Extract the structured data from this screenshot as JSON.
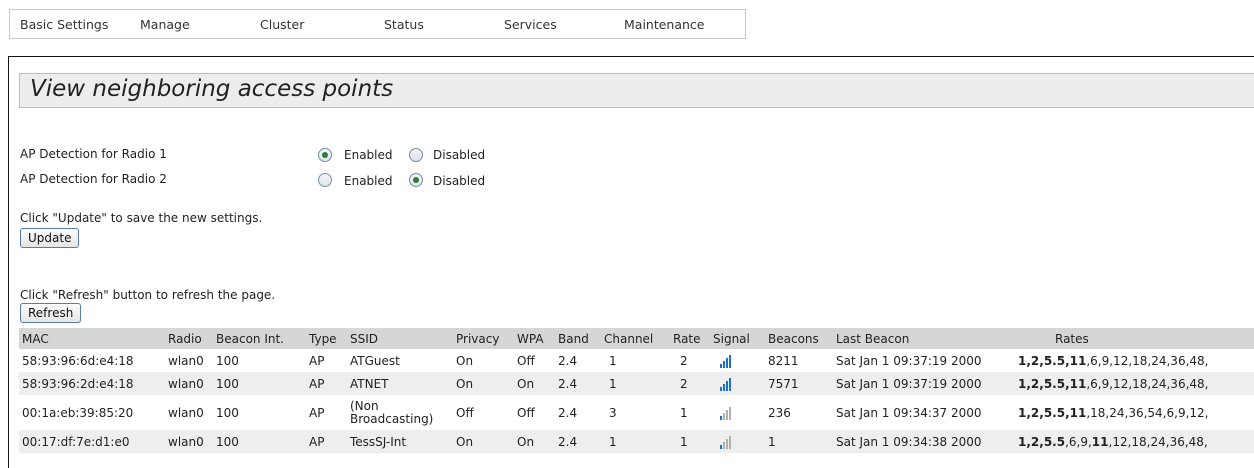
{
  "nav": {
    "tabs": [
      "Basic Settings",
      "Manage",
      "Cluster",
      "Status",
      "Services",
      "Maintenance"
    ]
  },
  "page": {
    "title": "View neighboring access points"
  },
  "detection": {
    "radio1": {
      "label": "AP Detection for Radio 1",
      "selected": "Enabled"
    },
    "radio2": {
      "label": "AP Detection for Radio 2",
      "selected": "Disabled"
    },
    "enabled_label": "Enabled",
    "disabled_label": "Disabled"
  },
  "update": {
    "hint": "Click \"Update\" to save the new settings.",
    "button_label": "Update"
  },
  "refresh": {
    "hint": "Click \"Refresh\" button to refresh the page.",
    "button_label": "Refresh"
  },
  "table": {
    "headers": [
      "MAC",
      "Radio",
      "Beacon Int.",
      "Type",
      "SSID",
      "Privacy",
      "WPA",
      "Band",
      "Channel",
      "Rate",
      "Signal",
      "Beacons",
      "Last Beacon",
      "Rates"
    ],
    "rows": [
      {
        "mac": "58:93:96:6d:e4:18",
        "radio": "wlan0",
        "beacon_int": "100",
        "type": "AP",
        "ssid": "ATGuest",
        "privacy": "On",
        "wpa": "Off",
        "band": "2.4",
        "channel": "1",
        "rate": "2",
        "signal_bars": 4,
        "beacons": "8211",
        "last_beacon": "Sat Jan 1 09:37:19 2000",
        "rates_bold": "1,2,5.5,11",
        "rates_rest": ",6,9,12,18,24,36,48,"
      },
      {
        "mac": "58:93:96:2d:e4:18",
        "radio": "wlan0",
        "beacon_int": "100",
        "type": "AP",
        "ssid": "ATNET",
        "privacy": "On",
        "wpa": "On",
        "band": "2.4",
        "channel": "1",
        "rate": "2",
        "signal_bars": 4,
        "beacons": "7571",
        "last_beacon": "Sat Jan 1 09:37:19 2000",
        "rates_bold": "1,2,5.5,11",
        "rates_rest": ",6,9,12,18,24,36,48,"
      },
      {
        "mac": "00:1a:eb:39:85:20",
        "radio": "wlan0",
        "beacon_int": "100",
        "type": "AP",
        "ssid": "(Non Broadcasting)",
        "privacy": "Off",
        "wpa": "Off",
        "band": "2.4",
        "channel": "3",
        "rate": "1",
        "signal_bars": 1,
        "beacons": "236",
        "last_beacon": "Sat Jan 1 09:34:37 2000",
        "rates_bold": "1,2,5.5,11",
        "rates_rest": ",18,24,36,54,6,9,12,"
      },
      {
        "mac": "00:17:df:7e:d1:e0",
        "radio": "wlan0",
        "beacon_int": "100",
        "type": "AP",
        "ssid": "TessSJ-Int",
        "privacy": "On",
        "wpa": "On",
        "band": "2.4",
        "channel": "1",
        "rate": "1",
        "signal_bars": 1,
        "beacons": "1",
        "last_beacon": "Sat Jan 1 09:34:38 2000",
        "rates_bold": "1,2,5.5",
        "rates_rest": ",6,9,",
        "rates_bold2": "11",
        "rates_rest2": ",12,18,24,36,48,"
      }
    ]
  },
  "colors": {
    "signal_on": "#1a73c8",
    "radio_dot": "#2f7d3a",
    "header_bg": "#d6d6d6",
    "stripe_bg": "#eeeeee"
  }
}
